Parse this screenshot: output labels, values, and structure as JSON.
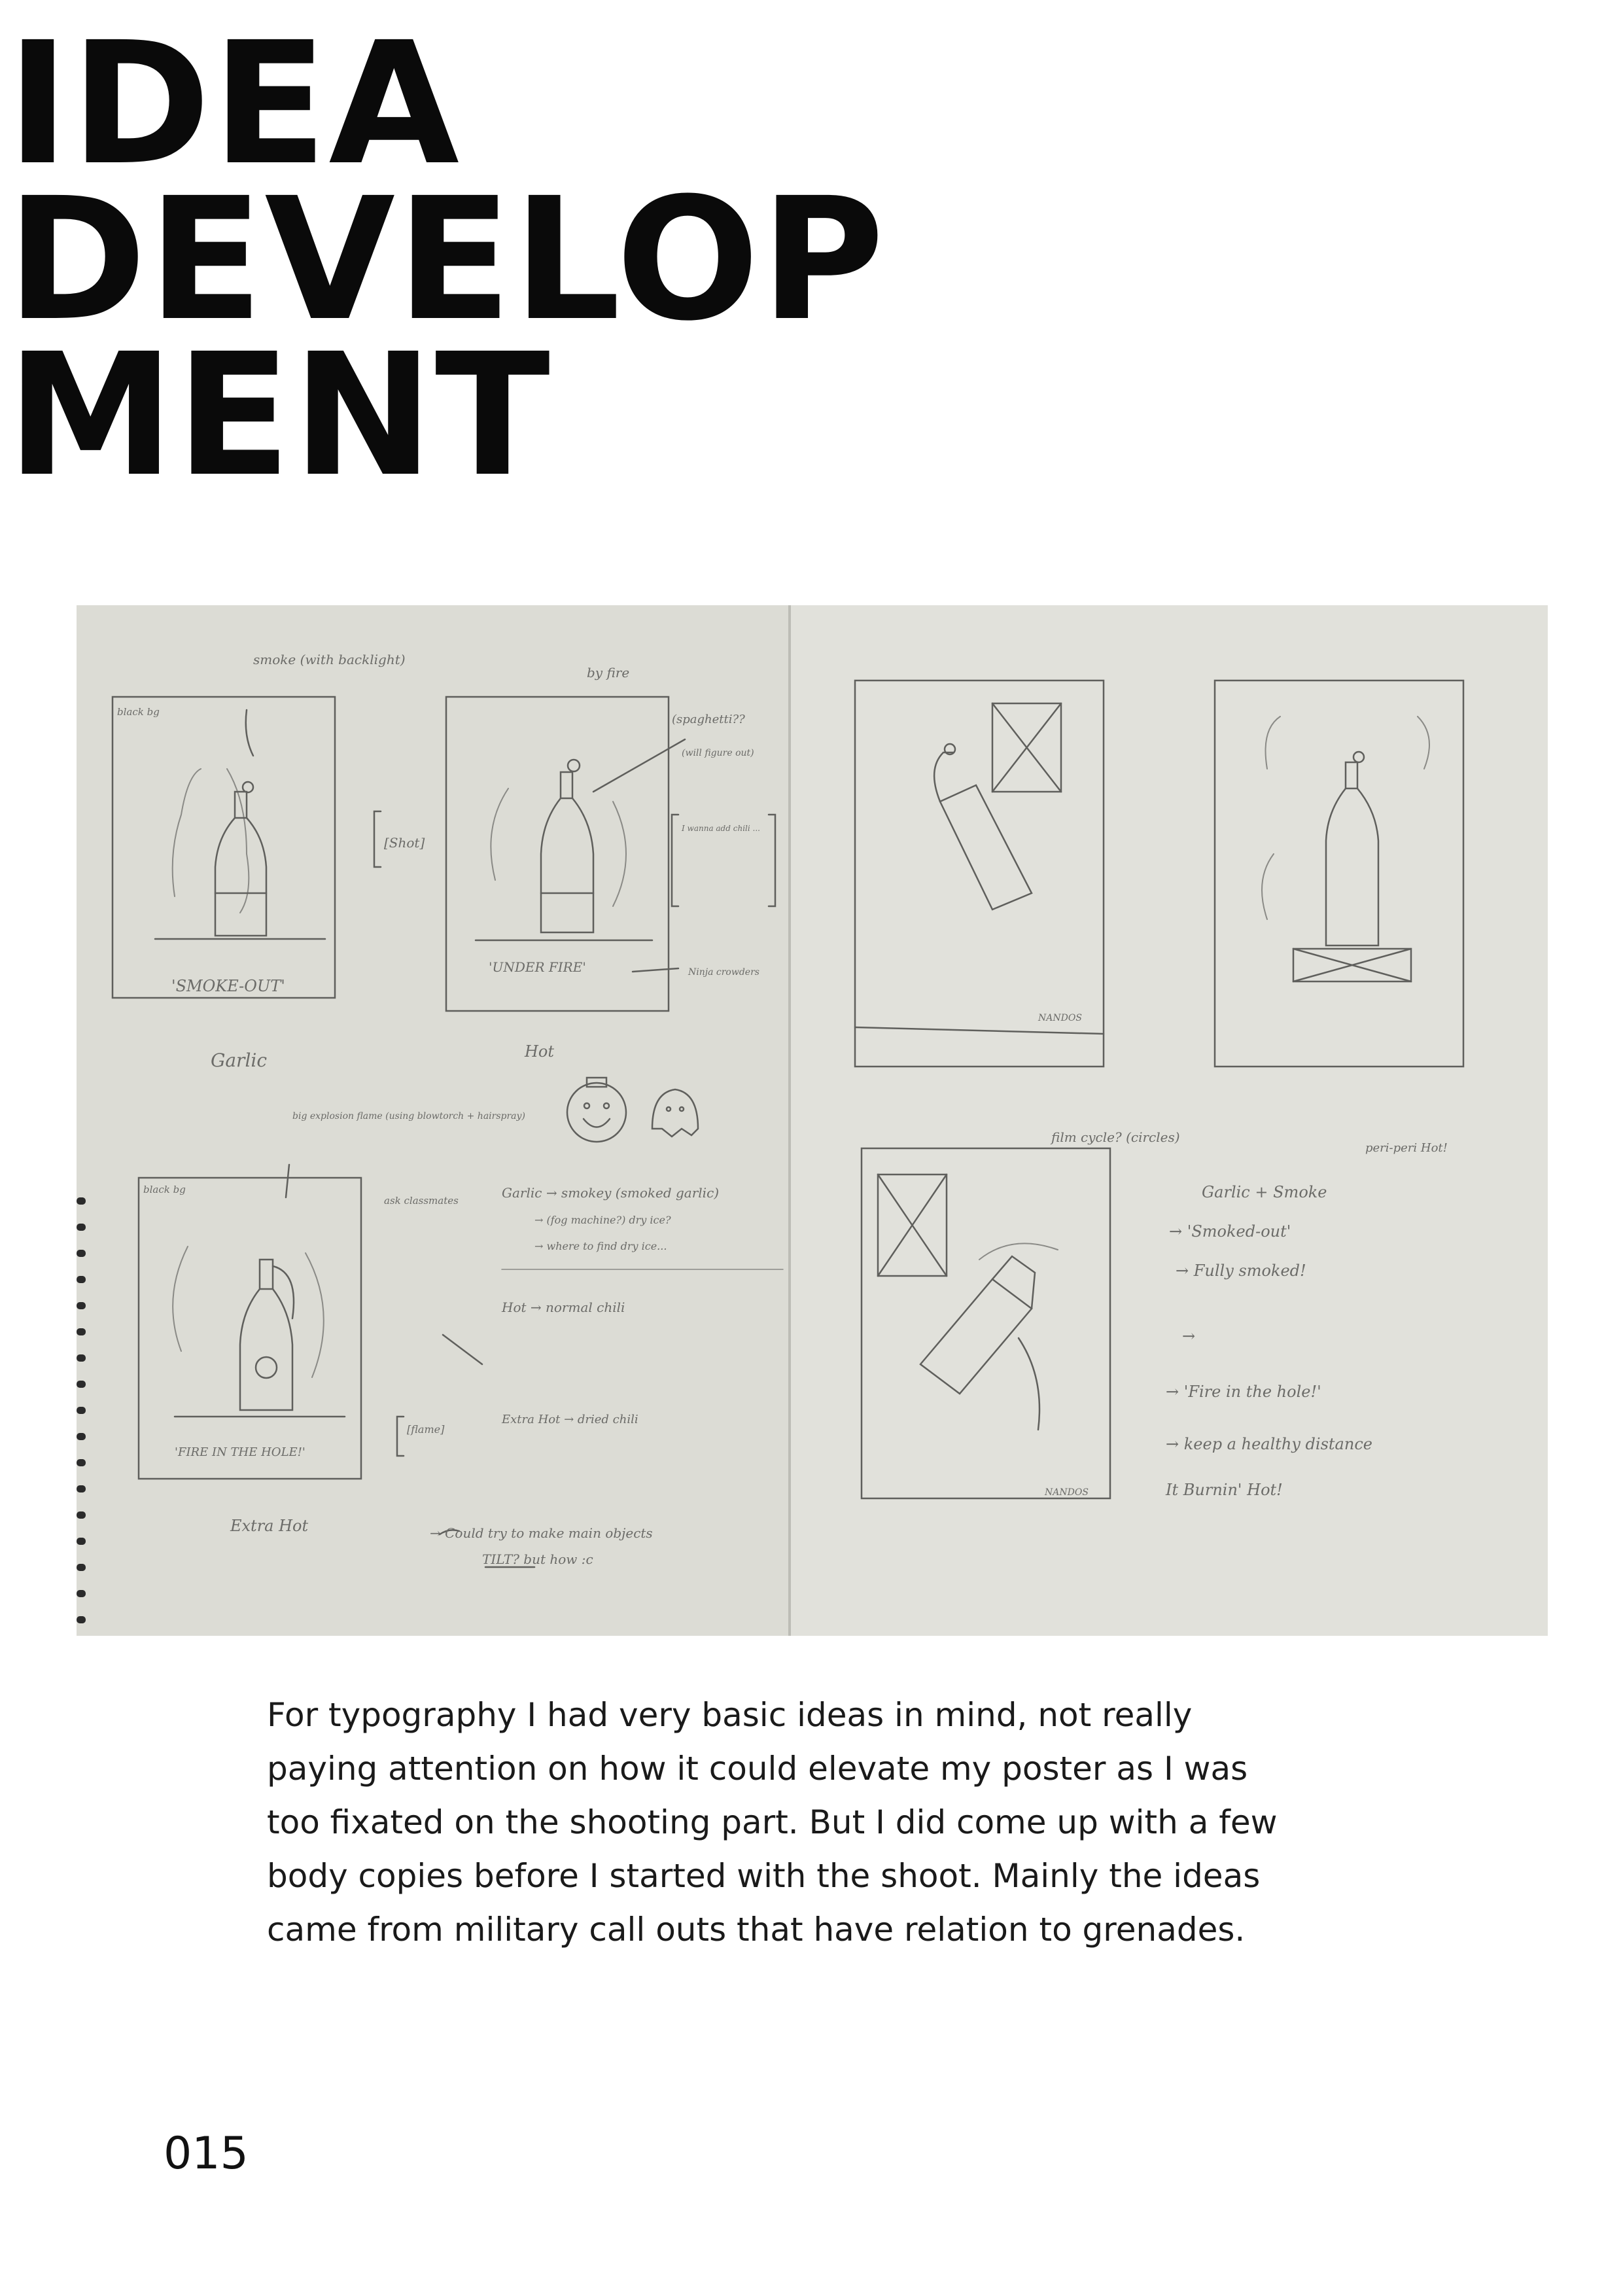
{
  "title": {
    "lines": [
      "IDEA",
      "DEVELOP",
      "MENT"
    ]
  },
  "sketchbook": {
    "labels": {
      "smoke_with_backlight": "smoke (with backlight)",
      "by_fire": "by fire",
      "black_bg_1": "black bg",
      "smoke_out": "'SMOKE-OUT'",
      "garlic": "Garlic",
      "shot": "[Shot]",
      "under_fire": "'UNDER FIRE'",
      "spaghetti": "(spaghetti??",
      "will_figure_out": "(will figure out)",
      "i_wanna_add_chili": "I wanna add chili ...",
      "ninja_crowders": "Ninja crowders",
      "hot": "Hot",
      "big_explosion": "big explosion flame (using blowtorch + hairspray)",
      "black_bg_2": "black bg",
      "ask_classmates": "ask classmates",
      "garlic_smokey": "Garlic → smokey (smoked garlic)",
      "fog_machine": "→ (fog machine?) dry ice?",
      "where_to_find_dry_ice": "→ where to find dry ice...",
      "hot_normal_chili": "Hot → normal chili",
      "extra_hot_dried_chili": "Extra Hot → dried chili",
      "flame": "[flame]",
      "fire_in_the_hole": "'FIRE IN THE HOLE!'",
      "extra_hot": "Extra Hot",
      "could_try": "→ Could try to make main objects",
      "tilt": "TILT? but how :c",
      "nandos_1": "NANDOS",
      "nandos_2": "NANDOS",
      "film_cycle": "film cycle? (circles)",
      "peri_peri_hot": "peri-peri Hot!",
      "garlic_smoke": "Garlic + Smoke",
      "smoked_out": "→ 'Smoked-out'",
      "fully_smoked": "→ Fully smoked!",
      "arrow": "→",
      "fire_in_the_hole_2": "→ 'Fire in the hole!'",
      "keep_distance": "→ keep a healthy distance",
      "its_burnin_hot": "It Burnin' Hot!"
    }
  },
  "body": {
    "text": "For typography I had very basic ideas in mind, not really\npaying attention on how it could elevate my poster as I was\ntoo fixated on the shooting part. But I did come up with a few\nbody copies before I started with the shoot. Mainly the ideas\ncame from military call outs that have relation to grenades."
  },
  "page_number": "015",
  "colors": {
    "paper_left": "#dcdcd4",
    "paper_right": "#e2e2dc",
    "pencil": "#5d5d5a"
  }
}
